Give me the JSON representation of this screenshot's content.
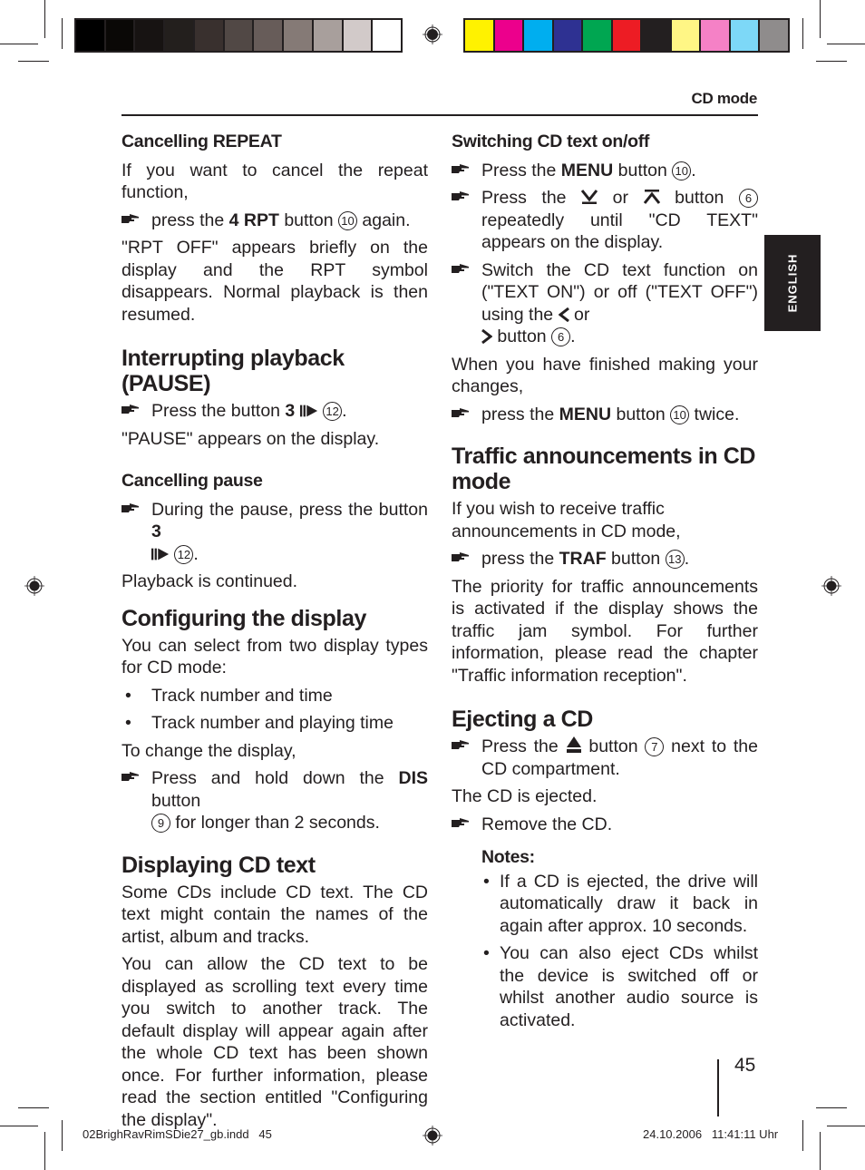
{
  "color_bars": {
    "grayscale": [
      "#000000",
      "#0a0806",
      "#171312",
      "#231f1d",
      "#39302e",
      "#514845",
      "#675c59",
      "#857a76",
      "#a89f9c",
      "#d2cac9",
      "#ffffff"
    ],
    "process": [
      "#fff200",
      "#ec008c",
      "#00aeef",
      "#2e3192",
      "#00a651",
      "#ed1c24",
      "#231f20",
      "#fff685",
      "#f581c6",
      "#7dd8f7",
      "#8f8c8c"
    ]
  },
  "header": {
    "title": "CD mode"
  },
  "lang_tab": {
    "label": "ENGLISH"
  },
  "left": {
    "cancel_repeat": {
      "heading": "Cancelling REPEAT",
      "intro": "If you want to cancel the repeat function,",
      "step": {
        "pre": "press the ",
        "bold": "4 RPT",
        "mid": " button ",
        "num": "10",
        "post": " again."
      },
      "result": "\"RPT OFF\" appears briefly on the display and the RPT symbol disappears. Normal playback is then resumed."
    },
    "pause": {
      "heading": "Interrupting playback (PAUSE)",
      "step": {
        "pre": "Press the button ",
        "bold": "3",
        "num": "12",
        "post": "."
      },
      "result": "\"PAUSE\" appears on the display."
    },
    "cancel_pause": {
      "heading": "Cancelling pause",
      "step": {
        "pre": "During the pause, press the button ",
        "bold": "3",
        "num": "12",
        "post": "."
      },
      "result": "Playback is continued."
    },
    "configure": {
      "heading": "Configuring the display",
      "intro": "You can select from two display types for CD mode:",
      "options": [
        "Track number and time",
        "Track number and playing time"
      ],
      "change": "To change the display,",
      "step": {
        "pre": "Press and hold down the ",
        "bold": "DIS",
        "mid": " button ",
        "num": "9",
        "post": " for longer than 2 seconds."
      }
    },
    "cd_text": {
      "heading": "Displaying CD text",
      "p1": "Some CDs include CD text. The CD text might contain the names of the artist, album and tracks.",
      "p2": "You can allow the CD text to be displayed as scrolling text every time you switch to another track. The default display will appear again after the whole CD text has been shown once. For further information, please read the section entitled \"Configuring the display\"."
    }
  },
  "right": {
    "switch_text": {
      "heading": "Switching CD text on/off",
      "step1": {
        "pre": "Press the ",
        "bold": "MENU",
        "mid": " button ",
        "num": "10",
        "post": "."
      },
      "step2": {
        "pre": "Press the ",
        "or": " or ",
        "mid": " button ",
        "num": "6",
        "post": " repeatedly until \"CD TEXT\" appears on the display."
      },
      "step3": {
        "pre": "Switch the CD text function on (\"TEXT ON\") or off (\"TEXT OFF\") using the ",
        "or": " or ",
        "mid": " button ",
        "num": "6",
        "post": "."
      },
      "finished": "When you have finished making your changes,",
      "step4": {
        "pre": "press the ",
        "bold": "MENU",
        "mid": " button ",
        "num": "10",
        "post": " twice."
      }
    },
    "traffic": {
      "heading": "Traffic announcements in CD mode",
      "intro": "If you wish to receive traffic announcements in CD mode,",
      "step": {
        "pre": "press the ",
        "bold": "TRAF",
        "mid": " button ",
        "num": "13",
        "post": "."
      },
      "body": "The priority for traffic announcements is activated if the display shows the traffic jam symbol. For further information, please read the chapter \"Traffic information reception\"."
    },
    "eject": {
      "heading": "Ejecting a CD",
      "step1": {
        "pre": "Press the ",
        "mid": " button ",
        "num": "7",
        "post": " next to the CD compartment."
      },
      "result": "The CD is ejected.",
      "step2": "Remove the CD.",
      "notes_label": "Notes:",
      "notes": [
        "If a CD is ejected, the drive will automatically draw it back in again after approx. 10 seconds.",
        "You can also eject CDs whilst the device is switched off or whilst another audio source is activated."
      ]
    }
  },
  "footer": {
    "page_number": "45",
    "slug_file": "02BrighRavRimSDie27_gb.indd   45",
    "slug_date": "24.10.2006   11:41:11 Uhr"
  }
}
